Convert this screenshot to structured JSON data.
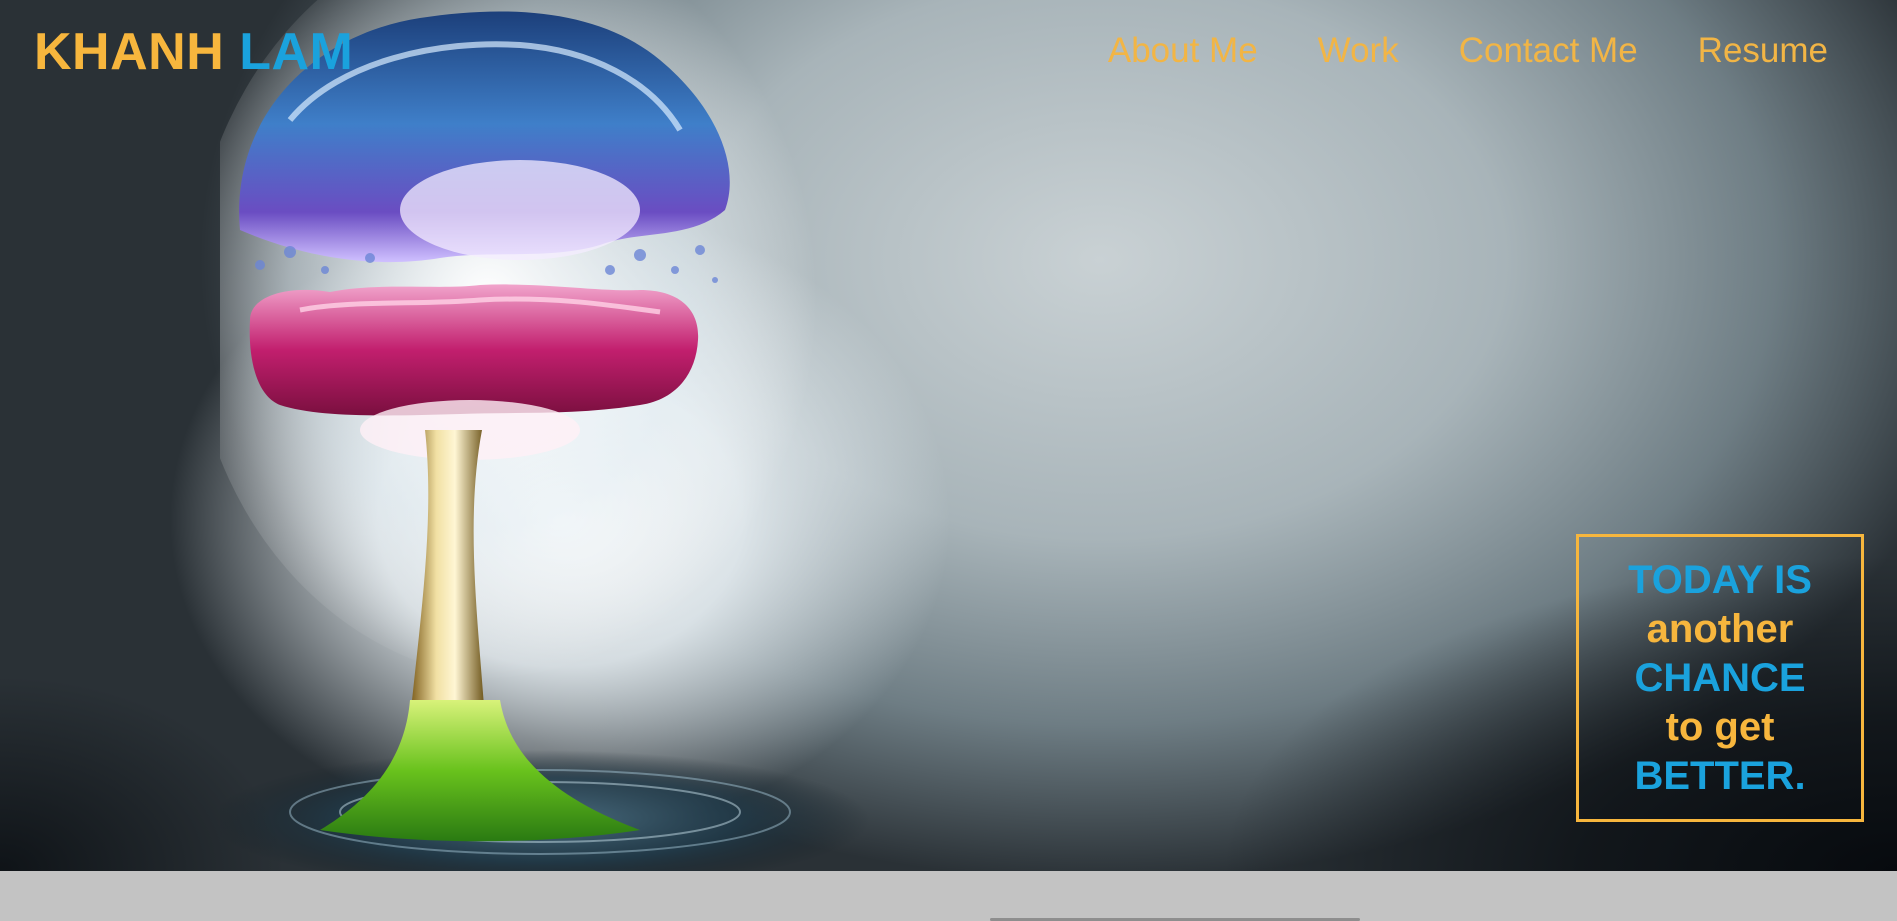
{
  "header": {
    "logo_first": "KHANH",
    "logo_last": "LAM"
  },
  "nav": {
    "items": [
      {
        "label": "About Me"
      },
      {
        "label": "Work"
      },
      {
        "label": "Contact Me"
      },
      {
        "label": "Resume"
      }
    ]
  },
  "quote": {
    "line1": "TODAY IS",
    "line2": "another",
    "line3": "CHANCE",
    "line4": "to get",
    "line5": "BETTER."
  },
  "colors": {
    "gold": "#f7b63d",
    "blue": "#1aa2dd",
    "footer": "#c3c3c3"
  },
  "hero": {
    "image": "water-splash-mushroom-cloud"
  }
}
